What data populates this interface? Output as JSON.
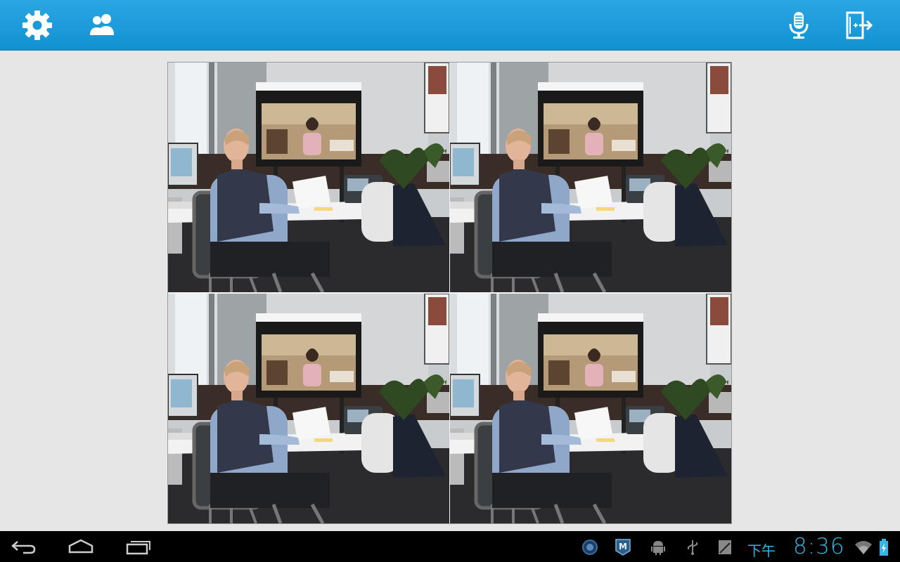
{
  "toolbar": {
    "left_icons": [
      "gear-icon",
      "participants-icon"
    ],
    "right_icons": [
      "microphone-icon",
      "exit-meeting-icon"
    ],
    "accent_color": "#1a9ad9"
  },
  "video_grid": {
    "layout": "2x2",
    "tiles": [
      {
        "id": "video-tile-1",
        "icon": "video-feed"
      },
      {
        "id": "video-tile-2",
        "icon": "video-feed"
      },
      {
        "id": "video-tile-3",
        "icon": "video-feed"
      },
      {
        "id": "video-tile-4",
        "icon": "video-feed"
      }
    ]
  },
  "system_bar": {
    "nav_icons": [
      "back-icon",
      "home-icon",
      "recent-apps-icon"
    ],
    "status_icons": [
      "app-notification-icon",
      "m-app-icon",
      "android-debug-icon",
      "usb-icon",
      "sd-card-icon",
      "wifi-icon",
      "battery-icon"
    ],
    "clock_ampm": "下午",
    "clock_time": "8:36",
    "clock_color": "#33b5e5"
  }
}
